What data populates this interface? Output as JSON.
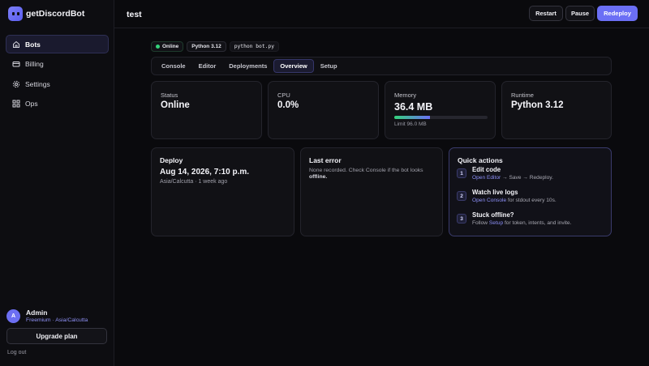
{
  "brand": {
    "name": "getDiscordBot"
  },
  "sidebar": {
    "items": [
      {
        "label": "Bots",
        "icon": "home-icon",
        "active": true
      },
      {
        "label": "Billing",
        "icon": "credit-card-icon"
      },
      {
        "label": "Settings",
        "icon": "gear-icon"
      },
      {
        "label": "Ops",
        "icon": "grid-icon"
      }
    ],
    "user": {
      "initial": "A",
      "name": "Admin",
      "plan": "Freemium · Asia/Calcutta"
    },
    "upgrade_label": "Upgrade plan",
    "logout_label": "Log out"
  },
  "header": {
    "title": "test",
    "restart_label": "Restart",
    "pause_label": "Pause",
    "redeploy_label": "Redeploy"
  },
  "badges": {
    "status": "Online",
    "runtime": "Python 3.12",
    "command": "python bot.py"
  },
  "tabs": [
    {
      "label": "Console"
    },
    {
      "label": "Editor"
    },
    {
      "label": "Deployments"
    },
    {
      "label": "Overview",
      "active": true
    },
    {
      "label": "Setup"
    }
  ],
  "stats": {
    "status": {
      "label": "Status",
      "value": "Online"
    },
    "cpu": {
      "label": "CPU",
      "value": "0.0%"
    },
    "memory": {
      "label": "Memory",
      "value": "36.4 MB",
      "limit": "Limit 96.0 MB",
      "fraction": 0.379
    },
    "runtime": {
      "label": "Runtime",
      "value": "Python 3.12"
    }
  },
  "deploy": {
    "title": "Deploy",
    "date": "Aug 14, 2026, 7:10 p.m.",
    "sub": "Asia/Calcutta · 1 week ago"
  },
  "last_error": {
    "title": "Last error",
    "text_before": "None recorded. Check Console if the bot looks ",
    "text_bold": "offline."
  },
  "quick_actions": {
    "title": "Quick actions",
    "items": [
      {
        "num": "1",
        "title": "Edit code",
        "link": "Open Editor",
        "rest": " → Save → Redeploy."
      },
      {
        "num": "2",
        "title": "Watch live logs",
        "link": "Open Console",
        "rest": " for stdout every 10s."
      },
      {
        "num": "3",
        "title": "Stuck offline?",
        "pre": "Follow ",
        "link": "Setup",
        "rest": " for token, intents, and invite."
      }
    ]
  },
  "colors": {
    "accent": "#6b6ff5",
    "online": "#34d27b",
    "background": "#0a0a0d"
  }
}
